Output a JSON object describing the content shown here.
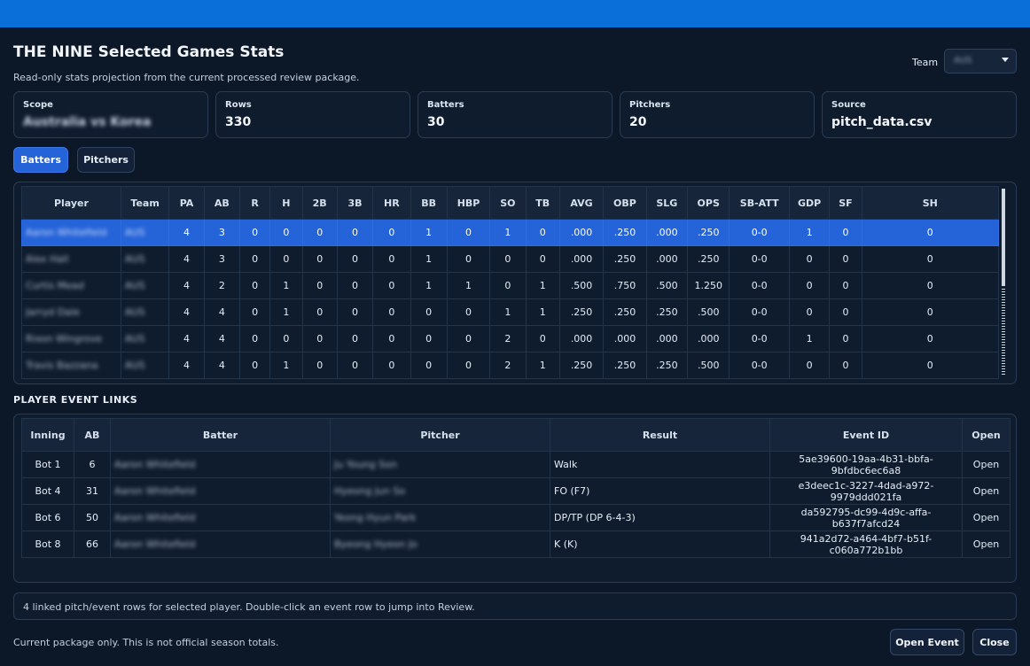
{
  "header": {
    "title": "THE NINE Selected Games Stats",
    "subtitle": "Read-only stats projection from the current processed review package.",
    "team_label": "Team",
    "team_value": "AUS"
  },
  "summary_cards": [
    {
      "label": "Scope",
      "value": "Australia vs Korea"
    },
    {
      "label": "Rows",
      "value": "330"
    },
    {
      "label": "Batters",
      "value": "30"
    },
    {
      "label": "Pitchers",
      "value": "20"
    },
    {
      "label": "Source",
      "value": "pitch_data.csv"
    }
  ],
  "tabs": {
    "batters": "Batters",
    "pitchers": "Pitchers"
  },
  "stats_table": {
    "columns": [
      "Player",
      "Team",
      "PA",
      "AB",
      "R",
      "H",
      "2B",
      "3B",
      "HR",
      "BB",
      "HBP",
      "SO",
      "TB",
      "AVG",
      "OBP",
      "SLG",
      "OPS",
      "SB-ATT",
      "GDP",
      "SF",
      "SH"
    ],
    "rows": [
      [
        "Aaron Whitefield",
        "AUS",
        "4",
        "3",
        "0",
        "0",
        "0",
        "0",
        "0",
        "1",
        "0",
        "1",
        "0",
        ".000",
        ".250",
        ".000",
        ".250",
        "0-0",
        "1",
        "0",
        "0"
      ],
      [
        "Alex Hall",
        "AUS",
        "4",
        "3",
        "0",
        "0",
        "0",
        "0",
        "0",
        "1",
        "0",
        "0",
        "0",
        ".000",
        ".250",
        ".000",
        ".250",
        "0-0",
        "0",
        "0",
        "0"
      ],
      [
        "Curtis Mead",
        "AUS",
        "4",
        "2",
        "0",
        "1",
        "0",
        "0",
        "0",
        "1",
        "1",
        "0",
        "1",
        ".500",
        ".750",
        ".500",
        "1.250",
        "0-0",
        "0",
        "0",
        "0"
      ],
      [
        "Jarryd Dale",
        "AUS",
        "4",
        "4",
        "0",
        "1",
        "0",
        "0",
        "0",
        "0",
        "0",
        "1",
        "1",
        ".250",
        ".250",
        ".250",
        ".500",
        "0-0",
        "0",
        "0",
        "0"
      ],
      [
        "Rixon Wingrove",
        "AUS",
        "4",
        "4",
        "0",
        "0",
        "0",
        "0",
        "0",
        "0",
        "0",
        "2",
        "0",
        ".000",
        ".000",
        ".000",
        ".000",
        "0-0",
        "1",
        "0",
        "0"
      ],
      [
        "Travis Bazzana",
        "AUS",
        "4",
        "4",
        "0",
        "1",
        "0",
        "0",
        "0",
        "0",
        "0",
        "2",
        "1",
        ".250",
        ".250",
        ".250",
        ".500",
        "0-0",
        "0",
        "0",
        "0"
      ]
    ]
  },
  "events": {
    "section_label": "PLAYER EVENT LINKS",
    "columns": [
      "Inning",
      "AB",
      "Batter",
      "Pitcher",
      "Result",
      "Event ID",
      "Open"
    ],
    "rows": [
      [
        "Bot 1",
        "6",
        "Aaron Whitefield",
        "Ju Young Son",
        "Walk",
        "5ae39600-19aa-4b31-bbfa-9bfdbc6ec6a8",
        "Open"
      ],
      [
        "Bot 4",
        "31",
        "Aaron Whitefield",
        "Hyeong Jun So",
        "FO (F7)",
        "e3deec1c-3227-4dad-a972-9979ddd021fa",
        "Open"
      ],
      [
        "Bot 6",
        "50",
        "Aaron Whitefield",
        "Yeong Hyun Park",
        "DP/TP (DP 6-4-3)",
        "da592795-dc99-4d9c-affa-b637f7afcd24",
        "Open"
      ],
      [
        "Bot 8",
        "66",
        "Aaron Whitefield",
        "Byeong Hyeon Jo",
        "K (K)",
        "941a2d72-a464-4bf7-b51f-c060a772b1bb",
        "Open"
      ]
    ]
  },
  "status_text": "4 linked pitch/event rows for selected player. Double-click an event row to jump into Review.",
  "footer": {
    "note": "Current package only. This is not official season totals.",
    "open_event": "Open Event",
    "close": "Close"
  },
  "colors": {
    "accent": "#2563d9",
    "titlebar": "#0a6fd8",
    "background": "#0c1727"
  }
}
